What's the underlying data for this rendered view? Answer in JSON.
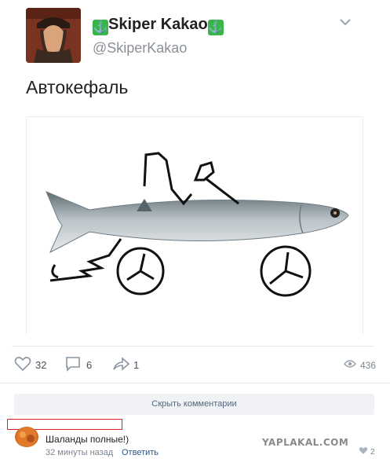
{
  "author": {
    "name": "Skiper Kakao",
    "handle": "@SkiperKakao"
  },
  "post": {
    "text": "Автокефаль"
  },
  "actions": {
    "likes": "32",
    "comments": "6",
    "shares": "1",
    "views": "436"
  },
  "comments_toggle": {
    "label": "Скрыть комментарии"
  },
  "comment": {
    "text": "Шаланды полные!)",
    "time": "32 минуты назад",
    "reply_label": "Ответить",
    "likes": "2"
  },
  "watermark": "YAPLAKAL.COM",
  "colors": {
    "anchor_badge": "#39b54a",
    "link": "#2a5885",
    "highlight_box": "#e0222a"
  }
}
